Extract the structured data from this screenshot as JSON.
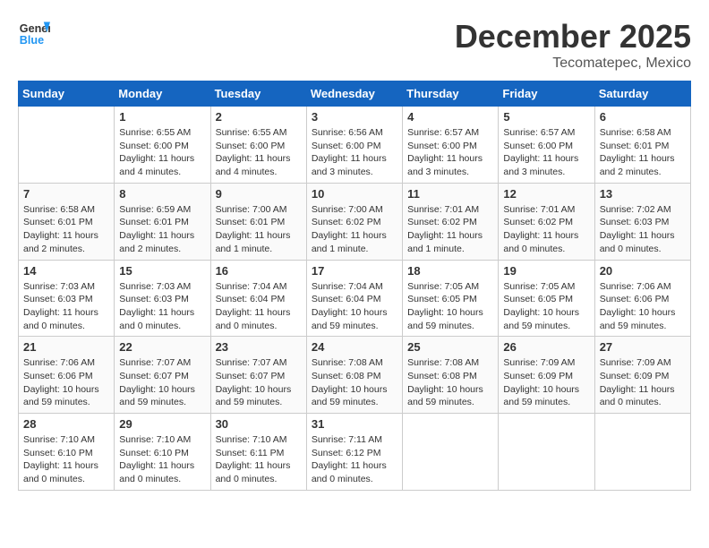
{
  "header": {
    "logo_line1": "General",
    "logo_line2": "Blue",
    "month": "December 2025",
    "location": "Tecomatepec, Mexico"
  },
  "weekdays": [
    "Sunday",
    "Monday",
    "Tuesday",
    "Wednesday",
    "Thursday",
    "Friday",
    "Saturday"
  ],
  "weeks": [
    [
      {
        "day": "",
        "empty": true
      },
      {
        "day": "1",
        "sunrise": "6:55 AM",
        "sunset": "6:00 PM",
        "daylight": "11 hours and 4 minutes."
      },
      {
        "day": "2",
        "sunrise": "6:55 AM",
        "sunset": "6:00 PM",
        "daylight": "11 hours and 4 minutes."
      },
      {
        "day": "3",
        "sunrise": "6:56 AM",
        "sunset": "6:00 PM",
        "daylight": "11 hours and 3 minutes."
      },
      {
        "day": "4",
        "sunrise": "6:57 AM",
        "sunset": "6:00 PM",
        "daylight": "11 hours and 3 minutes."
      },
      {
        "day": "5",
        "sunrise": "6:57 AM",
        "sunset": "6:00 PM",
        "daylight": "11 hours and 3 minutes."
      },
      {
        "day": "6",
        "sunrise": "6:58 AM",
        "sunset": "6:01 PM",
        "daylight": "11 hours and 2 minutes."
      }
    ],
    [
      {
        "day": "7",
        "sunrise": "6:58 AM",
        "sunset": "6:01 PM",
        "daylight": "11 hours and 2 minutes."
      },
      {
        "day": "8",
        "sunrise": "6:59 AM",
        "sunset": "6:01 PM",
        "daylight": "11 hours and 2 minutes."
      },
      {
        "day": "9",
        "sunrise": "7:00 AM",
        "sunset": "6:01 PM",
        "daylight": "11 hours and 1 minute."
      },
      {
        "day": "10",
        "sunrise": "7:00 AM",
        "sunset": "6:02 PM",
        "daylight": "11 hours and 1 minute."
      },
      {
        "day": "11",
        "sunrise": "7:01 AM",
        "sunset": "6:02 PM",
        "daylight": "11 hours and 1 minute."
      },
      {
        "day": "12",
        "sunrise": "7:01 AM",
        "sunset": "6:02 PM",
        "daylight": "11 hours and 0 minutes."
      },
      {
        "day": "13",
        "sunrise": "7:02 AM",
        "sunset": "6:03 PM",
        "daylight": "11 hours and 0 minutes."
      }
    ],
    [
      {
        "day": "14",
        "sunrise": "7:03 AM",
        "sunset": "6:03 PM",
        "daylight": "11 hours and 0 minutes."
      },
      {
        "day": "15",
        "sunrise": "7:03 AM",
        "sunset": "6:03 PM",
        "daylight": "11 hours and 0 minutes."
      },
      {
        "day": "16",
        "sunrise": "7:04 AM",
        "sunset": "6:04 PM",
        "daylight": "11 hours and 0 minutes."
      },
      {
        "day": "17",
        "sunrise": "7:04 AM",
        "sunset": "6:04 PM",
        "daylight": "10 hours and 59 minutes."
      },
      {
        "day": "18",
        "sunrise": "7:05 AM",
        "sunset": "6:05 PM",
        "daylight": "10 hours and 59 minutes."
      },
      {
        "day": "19",
        "sunrise": "7:05 AM",
        "sunset": "6:05 PM",
        "daylight": "10 hours and 59 minutes."
      },
      {
        "day": "20",
        "sunrise": "7:06 AM",
        "sunset": "6:06 PM",
        "daylight": "10 hours and 59 minutes."
      }
    ],
    [
      {
        "day": "21",
        "sunrise": "7:06 AM",
        "sunset": "6:06 PM",
        "daylight": "10 hours and 59 minutes."
      },
      {
        "day": "22",
        "sunrise": "7:07 AM",
        "sunset": "6:07 PM",
        "daylight": "10 hours and 59 minutes."
      },
      {
        "day": "23",
        "sunrise": "7:07 AM",
        "sunset": "6:07 PM",
        "daylight": "10 hours and 59 minutes."
      },
      {
        "day": "24",
        "sunrise": "7:08 AM",
        "sunset": "6:08 PM",
        "daylight": "10 hours and 59 minutes."
      },
      {
        "day": "25",
        "sunrise": "7:08 AM",
        "sunset": "6:08 PM",
        "daylight": "10 hours and 59 minutes."
      },
      {
        "day": "26",
        "sunrise": "7:09 AM",
        "sunset": "6:09 PM",
        "daylight": "10 hours and 59 minutes."
      },
      {
        "day": "27",
        "sunrise": "7:09 AM",
        "sunset": "6:09 PM",
        "daylight": "11 hours and 0 minutes."
      }
    ],
    [
      {
        "day": "28",
        "sunrise": "7:10 AM",
        "sunset": "6:10 PM",
        "daylight": "11 hours and 0 minutes."
      },
      {
        "day": "29",
        "sunrise": "7:10 AM",
        "sunset": "6:10 PM",
        "daylight": "11 hours and 0 minutes."
      },
      {
        "day": "30",
        "sunrise": "7:10 AM",
        "sunset": "6:11 PM",
        "daylight": "11 hours and 0 minutes."
      },
      {
        "day": "31",
        "sunrise": "7:11 AM",
        "sunset": "6:12 PM",
        "daylight": "11 hours and 0 minutes."
      },
      {
        "day": "",
        "empty": true
      },
      {
        "day": "",
        "empty": true
      },
      {
        "day": "",
        "empty": true
      }
    ]
  ],
  "labels": {
    "sunrise_prefix": "Sunrise: ",
    "sunset_prefix": "Sunset: ",
    "daylight_prefix": "Daylight: "
  }
}
